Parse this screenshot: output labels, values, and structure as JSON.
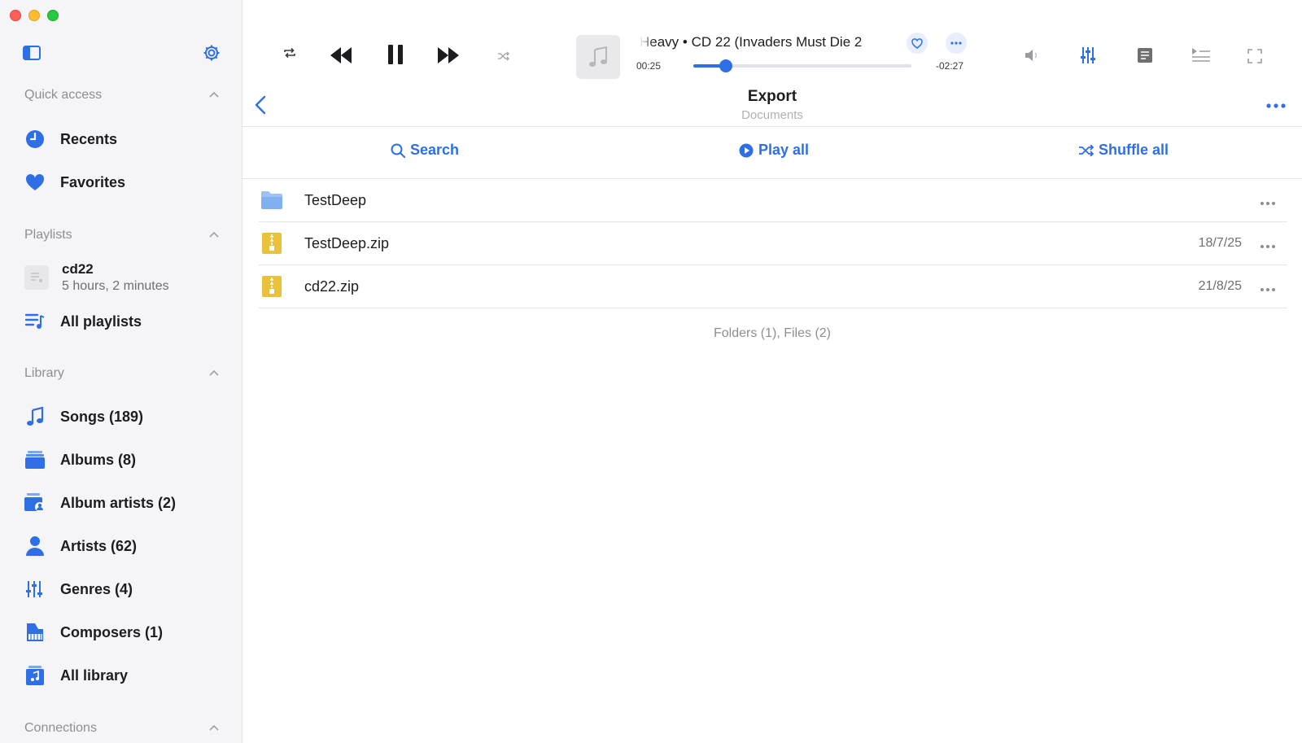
{
  "colors": {
    "accent": "#2f6fe6",
    "folder": "#7fb0f0",
    "zip": "#e9c13a"
  },
  "sidebar": {
    "quick_access": {
      "title": "Quick access",
      "items": [
        {
          "label": "Recents",
          "icon": "clock-icon"
        },
        {
          "label": "Favorites",
          "icon": "heart-icon"
        }
      ]
    },
    "playlists": {
      "title": "Playlists",
      "playlist": {
        "name": "cd22",
        "details": "5 hours, 2 minutes"
      },
      "all_label": "All playlists"
    },
    "library": {
      "title": "Library",
      "items": [
        {
          "label": "Songs (189)",
          "icon": "music-note-icon"
        },
        {
          "label": "Albums (8)",
          "icon": "albums-icon"
        },
        {
          "label": "Album artists (2)",
          "icon": "album-artists-icon"
        },
        {
          "label": "Artists (62)",
          "icon": "person-icon"
        },
        {
          "label": "Genres (4)",
          "icon": "genres-icon"
        },
        {
          "label": "Composers (1)",
          "icon": "piano-icon"
        },
        {
          "label": "All library",
          "icon": "library-icon"
        }
      ]
    },
    "connections": {
      "title": "Connections"
    }
  },
  "player": {
    "track_title": "Heavy • CD 22 (Invaders Must Die 2",
    "elapsed": "00:25",
    "remaining": "-02:27",
    "progress_fraction": 0.15
  },
  "header": {
    "title": "Export",
    "subtitle": "Documents"
  },
  "actions": {
    "search": "Search",
    "play_all": "Play all",
    "shuffle_all": "Shuffle all"
  },
  "files": [
    {
      "name": "TestDeep",
      "type": "folder",
      "date": ""
    },
    {
      "name": "TestDeep.zip",
      "type": "zip",
      "date": "18/7/25"
    },
    {
      "name": "cd22.zip",
      "type": "zip",
      "date": "21/8/25"
    }
  ],
  "summary": "Folders (1), Files (2)"
}
